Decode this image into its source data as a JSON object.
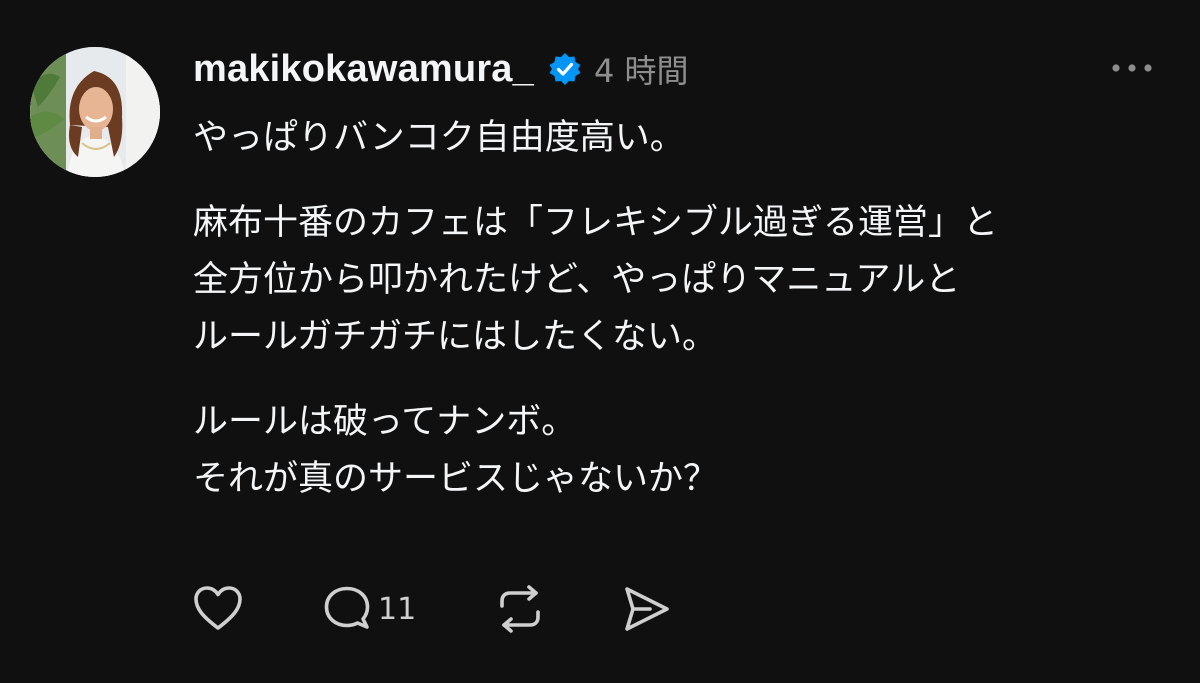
{
  "post": {
    "username": "makikokawamura_",
    "time": "4 時間",
    "paragraphs": [
      "やっぱりバンコク自由度高い。",
      "麻布十番のカフェは「フレキシブル過ぎる運営」と\n全方位から叩かれたけど、やっぱりマニュアルと\nルールガチガチにはしたくない。",
      "ルールは破ってナンボ。\nそれが真のサービスじゃないか？"
    ],
    "verified": true
  },
  "actions": {
    "like_icon": "heart-icon",
    "reply_icon": "comment-icon",
    "reply_count": "11",
    "repost_icon": "repost-icon",
    "share_icon": "send-icon"
  },
  "menu_icon": "more-icon",
  "colors": {
    "background": "#101010",
    "text": "#f3f5f7",
    "secondary": "#8e8e8e",
    "verified_badge": "#0095f6"
  }
}
